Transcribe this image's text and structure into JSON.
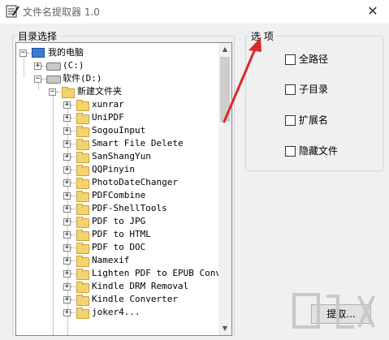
{
  "window": {
    "title": "文件名提取器 1.0",
    "close_glyph": "✕"
  },
  "tree": {
    "group_label": "目录选择",
    "nodes": [
      {
        "label": "我的电脑",
        "icon": "computer-icon"
      },
      {
        "label": "(C:)",
        "icon": "drive-icon"
      },
      {
        "label": "软件(D:)",
        "icon": "drive-icon"
      },
      {
        "label": "新建文件夹",
        "icon": "folder-icon"
      },
      {
        "label": "xunrar",
        "icon": "folder-icon"
      },
      {
        "label": "UniPDF",
        "icon": "folder-icon"
      },
      {
        "label": "SogouInput",
        "icon": "folder-icon"
      },
      {
        "label": "Smart File Delete",
        "icon": "folder-icon"
      },
      {
        "label": "SanShangYun",
        "icon": "folder-icon"
      },
      {
        "label": "QQPinyin",
        "icon": "folder-icon"
      },
      {
        "label": "PhotoDateChanger",
        "icon": "folder-icon"
      },
      {
        "label": "PDFCombine",
        "icon": "folder-icon"
      },
      {
        "label": "PDF-ShellTools",
        "icon": "folder-icon"
      },
      {
        "label": "PDF to JPG",
        "icon": "folder-icon"
      },
      {
        "label": "PDF to HTML",
        "icon": "folder-icon"
      },
      {
        "label": "PDF to DOC",
        "icon": "folder-icon"
      },
      {
        "label": "Namexif",
        "icon": "folder-icon"
      },
      {
        "label": "Lighten PDF to EPUB Conve",
        "icon": "folder-icon"
      },
      {
        "label": "Kindle DRM Removal",
        "icon": "folder-icon"
      },
      {
        "label": "Kindle Converter",
        "icon": "folder-icon"
      },
      {
        "label": "joker4...",
        "icon": "folder-icon"
      }
    ]
  },
  "options": {
    "group_label": "选 项",
    "items": [
      {
        "label": "全路径",
        "checked": false
      },
      {
        "label": "子目录",
        "checked": false
      },
      {
        "label": "扩展名",
        "checked": false
      },
      {
        "label": "隐藏文件",
        "checked": false
      }
    ]
  },
  "extract_button": {
    "label": "提取..."
  },
  "colors": {
    "annotation_arrow": "#d92b2b",
    "folder": "#f4d36f"
  }
}
